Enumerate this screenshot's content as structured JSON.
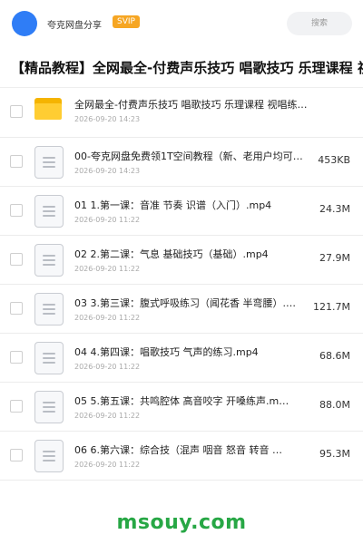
{
  "header": {
    "app_name": "夸克网盘分享",
    "badge": "SVIP",
    "search_placeholder": "搜索"
  },
  "page_title": "【精品教程】全网最全-付费声乐技巧 唱歌技巧 乐理课程 视",
  "files": [
    {
      "type": "folder",
      "name": "全网最全-付费声乐技巧 唱歌技巧 乐理课程 视唱练…",
      "date": "2026-09-20 14:23",
      "size": ""
    },
    {
      "type": "file",
      "name": "00-夸克网盘免费领1T空间教程（新、老用户均可）…",
      "date": "2026-09-20 14:23",
      "size": "453KB"
    },
    {
      "type": "file",
      "name": "01 1.第一课：音准 节奏 识谱（入门）.mp4",
      "date": "2026-09-20 11:22",
      "size": "24.3M"
    },
    {
      "type": "file",
      "name": "02 2.第二课：气息 基础技巧（基础）.mp4",
      "date": "2026-09-20 11:22",
      "size": "27.9M"
    },
    {
      "type": "file",
      "name": "03 3.第三课：腹式呼吸练习（闻花香 半弯腰）.…",
      "date": "2026-09-20 11:22",
      "size": "121.7M"
    },
    {
      "type": "file",
      "name": "04 4.第四课：唱歌技巧 气声的练习.mp4",
      "date": "2026-09-20 11:22",
      "size": "68.6M"
    },
    {
      "type": "file",
      "name": "05 5.第五课：共鸣腔体 高音咬字 开嗓练声.m…",
      "date": "2026-09-20 11:22",
      "size": "88.0M"
    },
    {
      "type": "file",
      "name": "06 6.第六课：综合技（混声 咽音 怒音 转音 …",
      "date": "2026-09-20 11:22",
      "size": "95.3M"
    }
  ],
  "watermark": "msouy.com"
}
